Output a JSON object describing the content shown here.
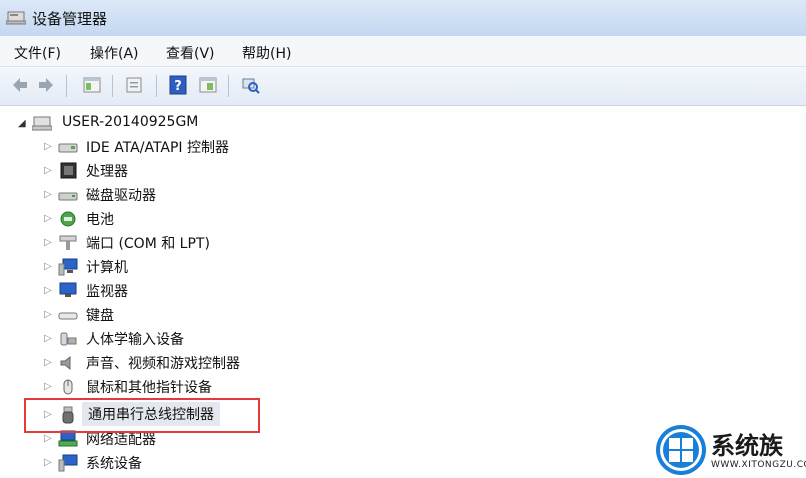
{
  "window": {
    "title": "设备管理器"
  },
  "menu": [
    {
      "label": "文件(F)"
    },
    {
      "label": "操作(A)"
    },
    {
      "label": "查看(V)"
    },
    {
      "label": "帮助(H)"
    }
  ],
  "toolbar": {
    "buttons": [
      "back-icon",
      "forward-icon",
      "properties-icon",
      "console-tree-icon",
      "help-icon",
      "details-icon",
      "scan-hardware-icon"
    ]
  },
  "tree": {
    "root": {
      "label": "USER-20140925GM",
      "expanded": true,
      "icon": "computer-icon"
    },
    "items": [
      {
        "label": "IDE ATA/ATAPI 控制器",
        "icon": "ide-controller-icon"
      },
      {
        "label": "处理器",
        "icon": "processor-icon"
      },
      {
        "label": "磁盘驱动器",
        "icon": "disk-drive-icon"
      },
      {
        "label": "电池",
        "icon": "battery-icon"
      },
      {
        "label": "端口 (COM 和 LPT)",
        "icon": "port-icon"
      },
      {
        "label": "计算机",
        "icon": "computer-icon"
      },
      {
        "label": "监视器",
        "icon": "monitor-icon"
      },
      {
        "label": "键盘",
        "icon": "keyboard-icon"
      },
      {
        "label": "人体学输入设备",
        "icon": "hid-icon"
      },
      {
        "label": "声音、视频和游戏控制器",
        "icon": "sound-icon"
      },
      {
        "label": "鼠标和其他指针设备",
        "icon": "mouse-icon"
      },
      {
        "label": "通用串行总线控制器",
        "icon": "usb-icon",
        "selected": true
      },
      {
        "label": "网络适配器",
        "icon": "network-adapter-icon"
      },
      {
        "label": "系统设备",
        "icon": "system-device-icon"
      }
    ]
  },
  "watermark": {
    "brand": "系统族",
    "url": "WWW.XITONGZU.COM"
  },
  "colors": {
    "highlight_border": "#e53a3a",
    "brand_blue": "#1a7fd6"
  }
}
